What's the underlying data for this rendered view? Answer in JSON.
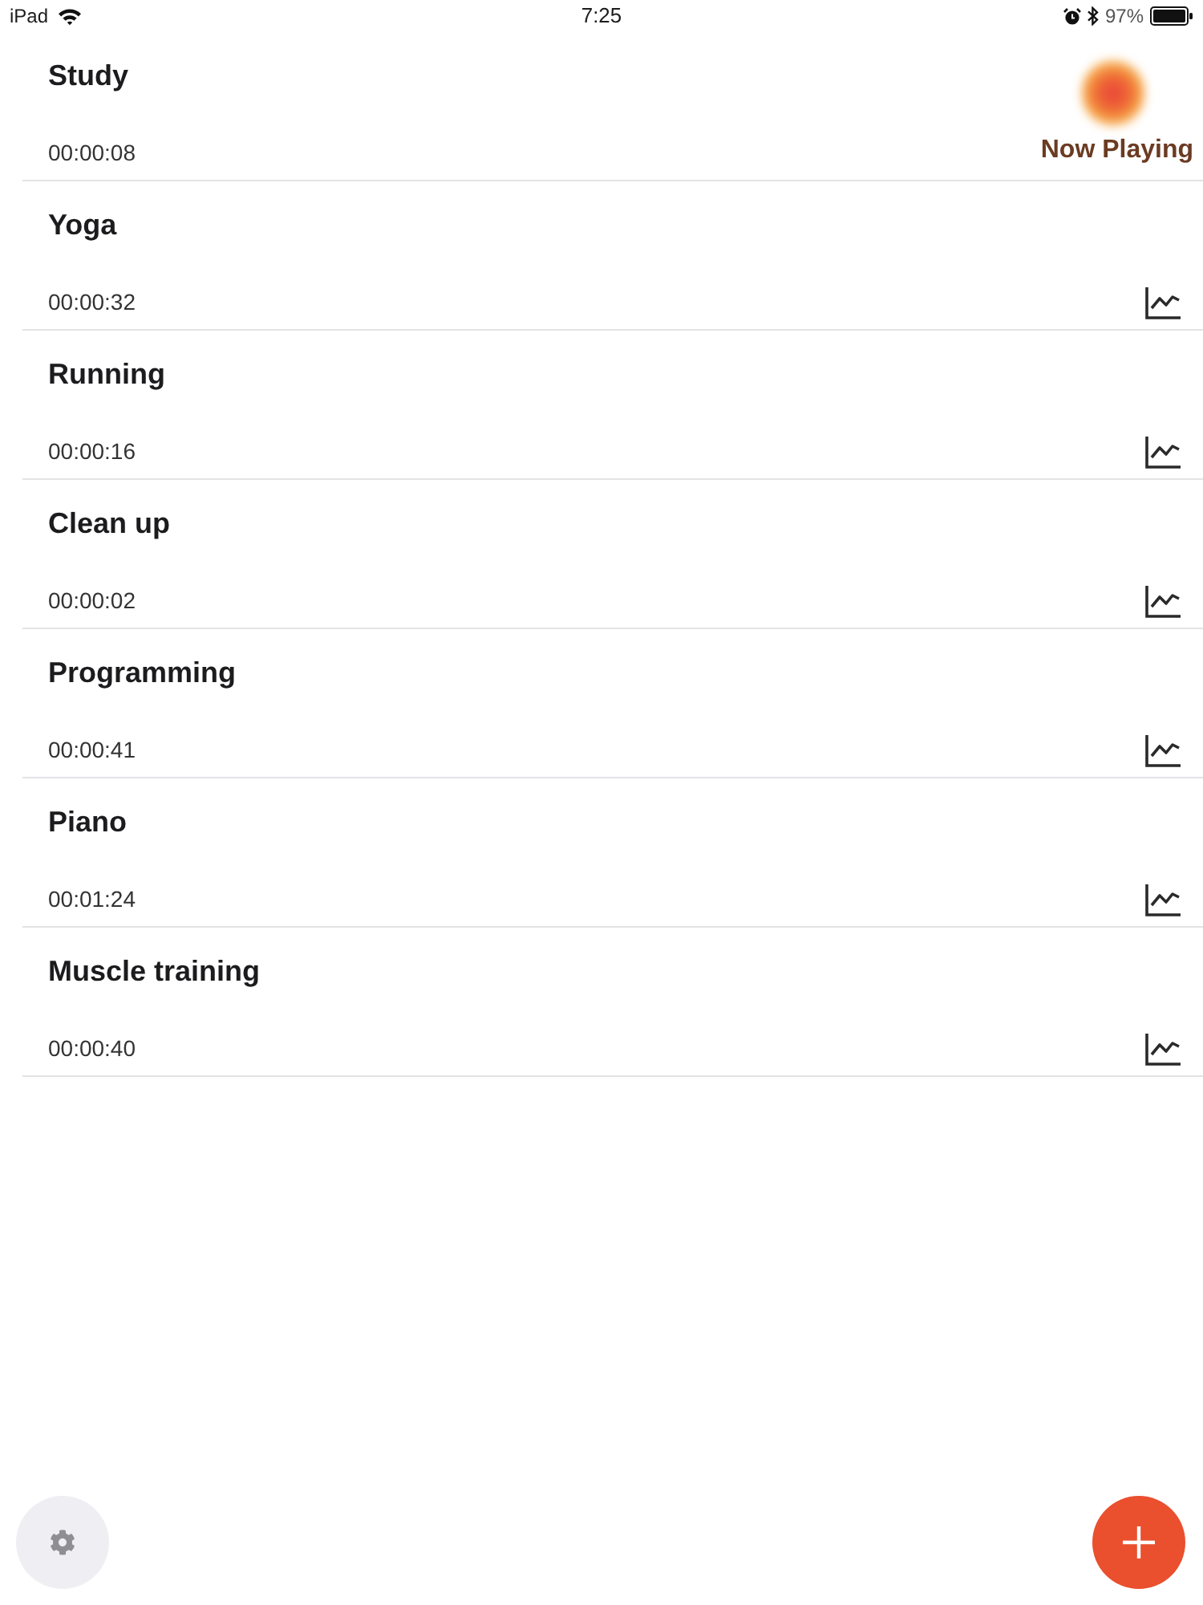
{
  "status_bar": {
    "device": "iPad",
    "time": "7:25",
    "battery": "97%"
  },
  "activities": [
    {
      "name": "Study",
      "elapsed": "00:00:08",
      "kind": "playing",
      "status": "Now Playing"
    },
    {
      "name": "Yoga",
      "elapsed": "00:00:32",
      "kind": "idle"
    },
    {
      "name": "Running",
      "elapsed": "00:00:16",
      "kind": "idle"
    },
    {
      "name": "Clean up",
      "elapsed": "00:00:02",
      "kind": "idle"
    },
    {
      "name": "Programming",
      "elapsed": "00:00:41",
      "kind": "idle"
    },
    {
      "name": "Piano",
      "elapsed": "00:01:24",
      "kind": "idle"
    },
    {
      "name": "Muscle training",
      "elapsed": "00:00:40",
      "kind": "idle"
    }
  ]
}
